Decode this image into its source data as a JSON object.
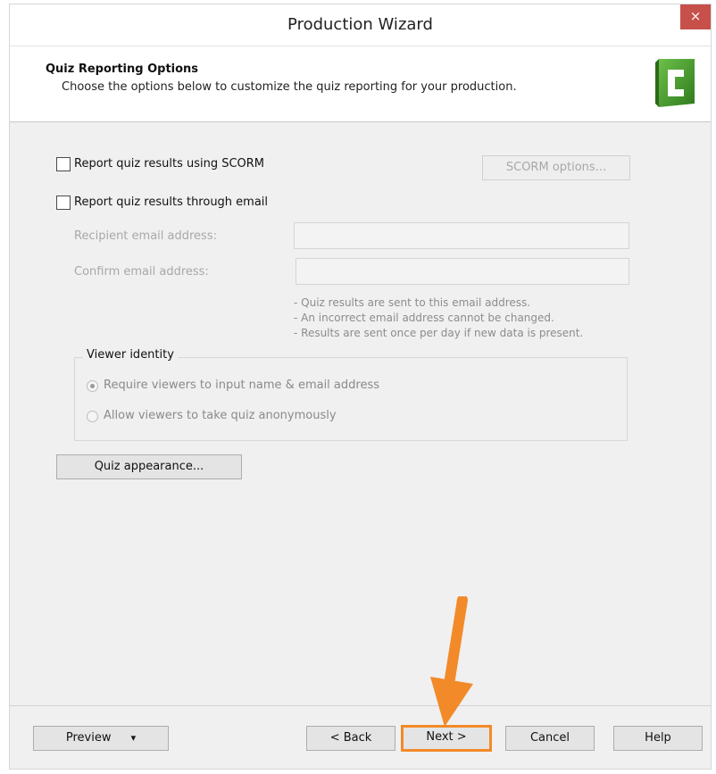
{
  "window": {
    "title": "Production Wizard",
    "close_glyph": "×"
  },
  "header": {
    "title": "Quiz Reporting Options",
    "subtitle": "Choose the options below to customize the quiz reporting for your production."
  },
  "scorm": {
    "checkbox_label": "Report quiz results using SCORM",
    "options_button": "SCORM options..."
  },
  "email": {
    "checkbox_label": "Report quiz results through email",
    "recipient_label": "Recipient email address:",
    "confirm_label": "Confirm email address:",
    "recipient_value": "",
    "confirm_value": "",
    "notes": [
      "- Quiz results are sent to this email address.",
      "- An incorrect email address cannot be changed.",
      "- Results are sent once per day if new data is present."
    ]
  },
  "viewer_identity": {
    "title": "Viewer identity",
    "options": [
      {
        "label": "Require viewers to input name & email address",
        "selected": true
      },
      {
        "label": "Allow viewers to take quiz anonymously",
        "selected": false
      }
    ]
  },
  "quiz_appearance_button": "Quiz appearance...",
  "footer": {
    "preview": "Preview",
    "preview_dropdown_glyph": "▾",
    "back": "< Back",
    "next": "Next >",
    "cancel": "Cancel",
    "help": "Help"
  },
  "colors": {
    "accent_arrow": "#f28a2a",
    "close_button": "#c7504b",
    "logo_green": "#4a9a2c"
  },
  "icons": [
    "close-icon",
    "camtasia-logo-icon",
    "dropdown-arrow-icon",
    "pointer-arrow-icon"
  ]
}
